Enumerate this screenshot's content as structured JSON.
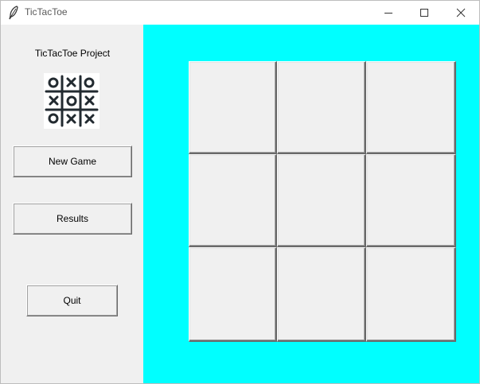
{
  "window": {
    "title": "TicTacToe",
    "controls": {
      "minimize": "minimize",
      "maximize": "maximize",
      "close": "close"
    }
  },
  "sidebar": {
    "project_label": "TicTacToe Project",
    "logo_icon": "tictactoe-logo-icon",
    "buttons": {
      "new_game": "New Game",
      "results": "Results",
      "quit": "Quit"
    }
  },
  "board": {
    "background_color": "#00ffff",
    "cells": [
      "",
      "",
      "",
      "",
      "",
      "",
      "",
      "",
      ""
    ]
  }
}
